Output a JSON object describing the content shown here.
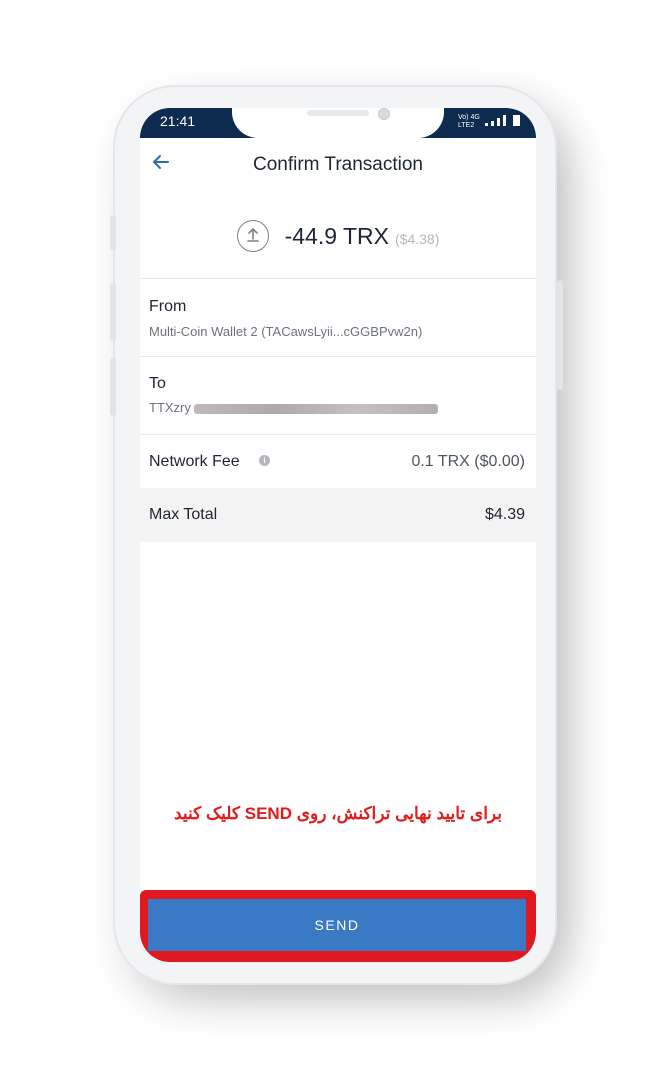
{
  "status_bar": {
    "time": "21:41",
    "network_top": "Vo) 4G",
    "network_bottom": "LTE2"
  },
  "header": {
    "title": "Confirm Transaction",
    "back_icon": "arrow-left-icon"
  },
  "amount": {
    "value": "-44.9 TRX",
    "usd": "($4.38)",
    "icon": "upload-arrow-icon"
  },
  "from": {
    "label": "From",
    "value": "Multi-Coin Wallet 2 (TACawsLyii...cGGBPvw2n)"
  },
  "to": {
    "label": "To",
    "value": "TTXzry"
  },
  "network_fee": {
    "label": "Network Fee",
    "value": "0.1 TRX ($0.00)",
    "icon": "info-icon"
  },
  "max_total": {
    "label": "Max Total",
    "value": "$4.39"
  },
  "instruction": "برای تایید نهایی تراکنش، روی SEND کلیک کنید",
  "send_button": {
    "label": "SEND"
  },
  "colors": {
    "accent": "#3a79c4",
    "highlight": "#e01820",
    "status_bar": "#0d2a4f"
  }
}
